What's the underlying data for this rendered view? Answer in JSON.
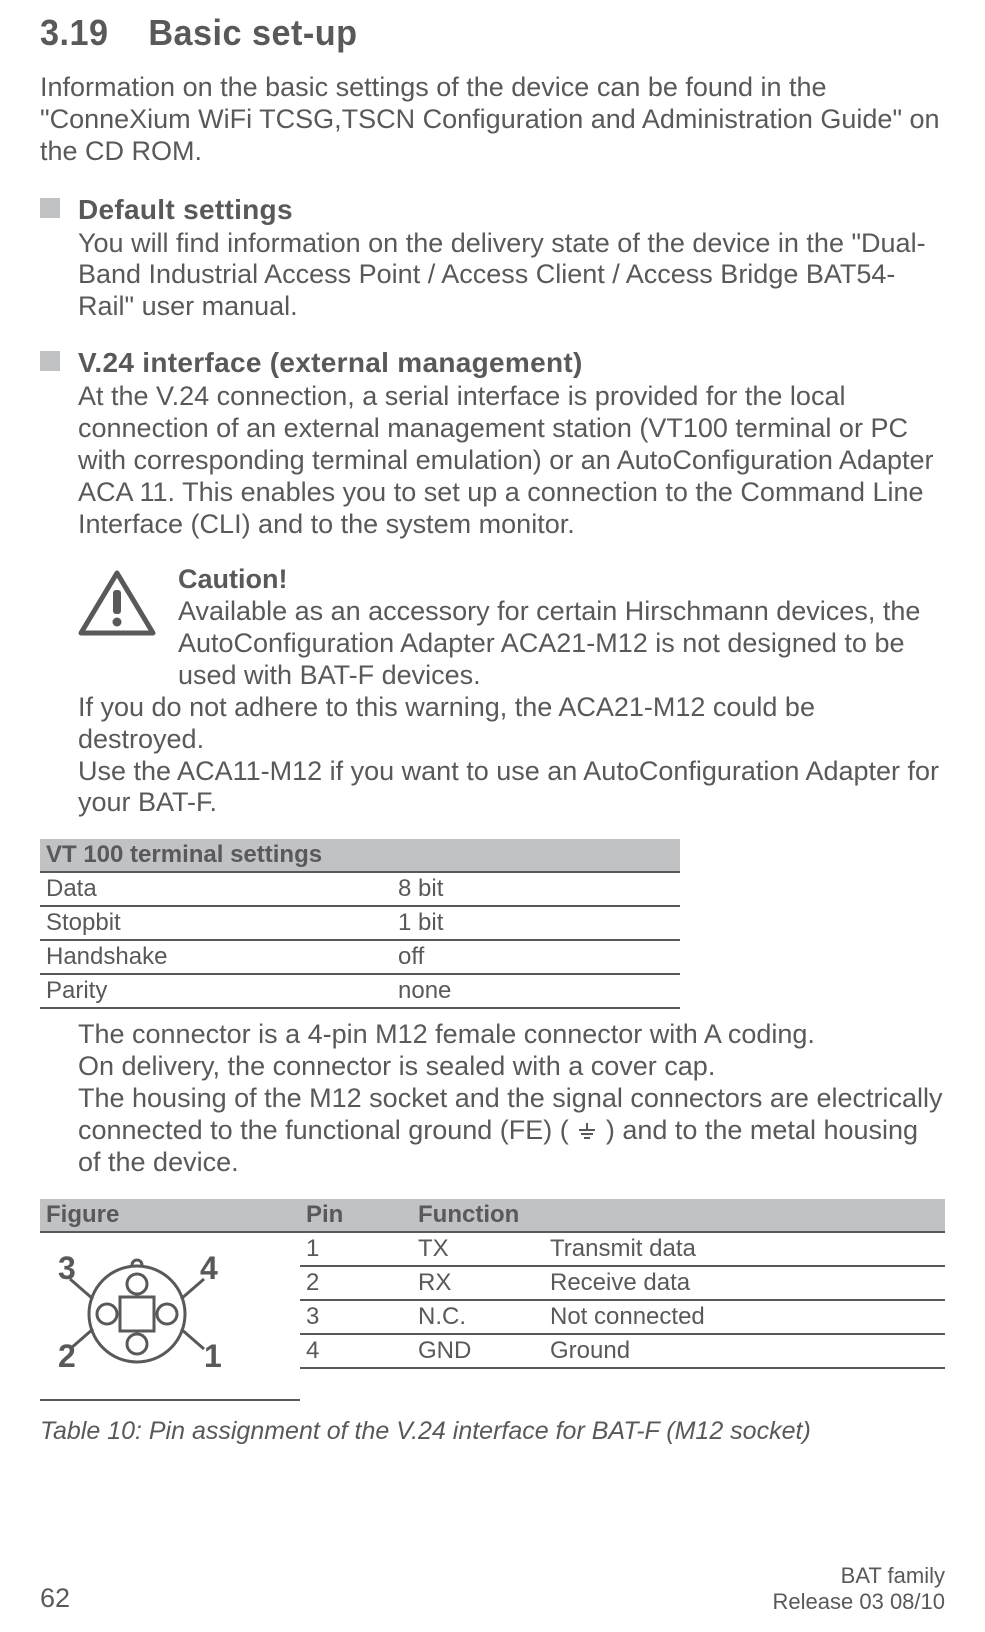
{
  "heading": {
    "number": "3.19",
    "title": "Basic set-up"
  },
  "intro": "Information on the basic settings of the device can be found in the \"ConneXium WiFi TCSG,TSCN Configuration and Administration Guide\" on the CD ROM.",
  "subsections": [
    {
      "title": "Default settings",
      "body": "You will find information on the delivery state of the device in the \"Dual-Band Industrial Access Point / Access Client / Access Bridge BAT54-Rail\" user manual."
    },
    {
      "title": "V.24 interface (external management)",
      "body": "At the V.24 connection, a serial interface is provided for the local connection of an external management station (VT100 terminal or PC with corresponding terminal emulation) or an AutoConfiguration Adapter ACA 11. This enables you to set up a connection to the Command Line Interface (CLI) and to the system monitor."
    }
  ],
  "caution": {
    "title": "Caution!",
    "para1": "Available as an accessory for certain Hirschmann devices, the AutoConfiguration Adapter ACA21-M12 is not designed to be used with BAT-F devices.",
    "para2": "If you do not adhere to this warning, the ACA21-M12 could be destroyed.",
    "para3": "Use the ACA11-M12 if you want to use an AutoConfiguration Adapter for your BAT-F."
  },
  "vt100": {
    "header": "VT 100 terminal settings",
    "rows": [
      {
        "label": "Data",
        "value": "8 bit"
      },
      {
        "label": "Stopbit",
        "value": "1 bit"
      },
      {
        "label": "Handshake",
        "value": "off"
      },
      {
        "label": "Parity",
        "value": "none"
      }
    ]
  },
  "connector_text": {
    "p1": "The connector is a 4-pin M12 female connector with A coding.",
    "p2": "On delivery, the connector is sealed with a cover cap.",
    "p3a": "The housing of the M12 socket and the signal connectors are electrically connected to the functional ground (FE)  (",
    "p3b": ") and to the metal housing of the device."
  },
  "pin_table": {
    "headers": {
      "figure": "Figure",
      "pin": "Pin",
      "function": "Function"
    },
    "rows": [
      {
        "pin": "1",
        "signal": "TX",
        "desc": "Transmit data"
      },
      {
        "pin": "2",
        "signal": "RX",
        "desc": "Receive data"
      },
      {
        "pin": "3",
        "signal": "N.C.",
        "desc": "Not connected"
      },
      {
        "pin": "4",
        "signal": "GND",
        "desc": "Ground"
      }
    ],
    "figure_labels": {
      "tl": "3",
      "tr": "4",
      "bl": "2",
      "br": "1"
    }
  },
  "table_caption": "Table 10: Pin assignment of the V.24 interface for BAT-F (M12 socket)",
  "footer": {
    "page": "62",
    "line1": "BAT family",
    "line2": "Release  03  08/10"
  }
}
